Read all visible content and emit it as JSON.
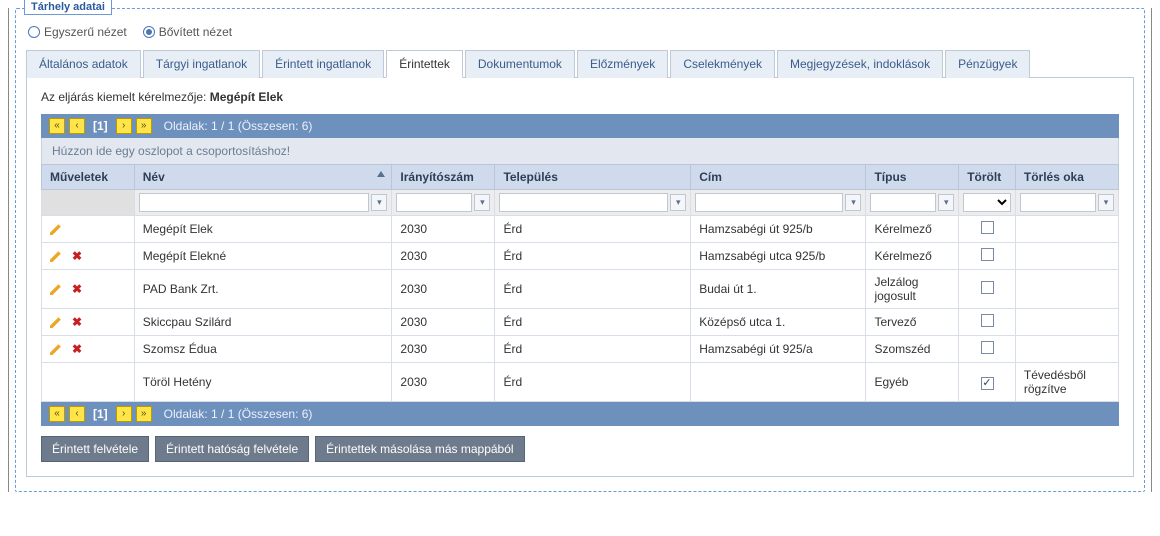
{
  "panel": {
    "title": "Tárhely adatai"
  },
  "view": {
    "simple": "Egyszerű nézet",
    "extended": "Bővített nézet",
    "selected": "extended"
  },
  "tabs": [
    {
      "id": "altalanos",
      "label": "Általános adatok"
    },
    {
      "id": "targyi",
      "label": "Tárgyi ingatlanok"
    },
    {
      "id": "erintett-ing",
      "label": "Érintett ingatlanok"
    },
    {
      "id": "erintettek",
      "label": "Érintettek",
      "active": true
    },
    {
      "id": "dokumentumok",
      "label": "Dokumentumok"
    },
    {
      "id": "elozmenyek",
      "label": "Előzmények"
    },
    {
      "id": "cselekmenyek",
      "label": "Cselekmények"
    },
    {
      "id": "megjegyzesek",
      "label": "Megjegyzések, indoklások"
    },
    {
      "id": "penzugyek",
      "label": "Pénzügyek"
    }
  ],
  "highlight": {
    "prefix": "Az eljárás kiemelt kérelmezője: ",
    "name": "Megépít Elek"
  },
  "pager": {
    "first": "«",
    "prev": "‹",
    "page": "[1]",
    "next": "›",
    "last": "»",
    "info": "Oldalak: 1 / 1  (Összesen: 6)"
  },
  "groupbar": "Húzzon ide egy oszlopot a csoportosításhoz!",
  "columns": {
    "ops": "Műveletek",
    "name": "Név",
    "zip": "Irányítószám",
    "city": "Település",
    "addr": "Cím",
    "type": "Típus",
    "deleted": "Törölt",
    "delreason": "Törlés oka",
    "sort": "name"
  },
  "rows": [
    {
      "edit": true,
      "del": false,
      "name": "Megépít Elek",
      "zip": "2030",
      "city": "Érd",
      "addr": "Hamzsabégi út 925/b",
      "type": "Kérelmező",
      "deleted": false,
      "delreason": ""
    },
    {
      "edit": true,
      "del": true,
      "name": "Megépít Elekné",
      "zip": "2030",
      "city": "Érd",
      "addr": "Hamzsabégi utca 925/b",
      "type": "Kérelmező",
      "deleted": false,
      "delreason": ""
    },
    {
      "edit": true,
      "del": true,
      "name": "PAD Bank Zrt.",
      "zip": "2030",
      "city": "Érd",
      "addr": "Budai út 1.",
      "type": "Jelzálog jogosult",
      "deleted": false,
      "delreason": ""
    },
    {
      "edit": true,
      "del": true,
      "name": "Skiccpau Szilárd",
      "zip": "2030",
      "city": "Érd",
      "addr": "Középső utca 1.",
      "type": "Tervező",
      "deleted": false,
      "delreason": ""
    },
    {
      "edit": true,
      "del": true,
      "name": "Szomsz Édua",
      "zip": "2030",
      "city": "Érd",
      "addr": "Hamzsabégi út 925/a",
      "type": "Szomszéd",
      "deleted": false,
      "delreason": ""
    },
    {
      "edit": false,
      "del": false,
      "name": "Töröl Hetény",
      "zip": "2030",
      "city": "Érd",
      "addr": "",
      "type": "Egyéb",
      "deleted": true,
      "delreason": "Tévedésből rögzítve"
    }
  ],
  "buttons": {
    "add": "Érintett felvétele",
    "addAuthority": "Érintett hatóság felvétele",
    "copy": "Érintettek másolása más mappából"
  }
}
